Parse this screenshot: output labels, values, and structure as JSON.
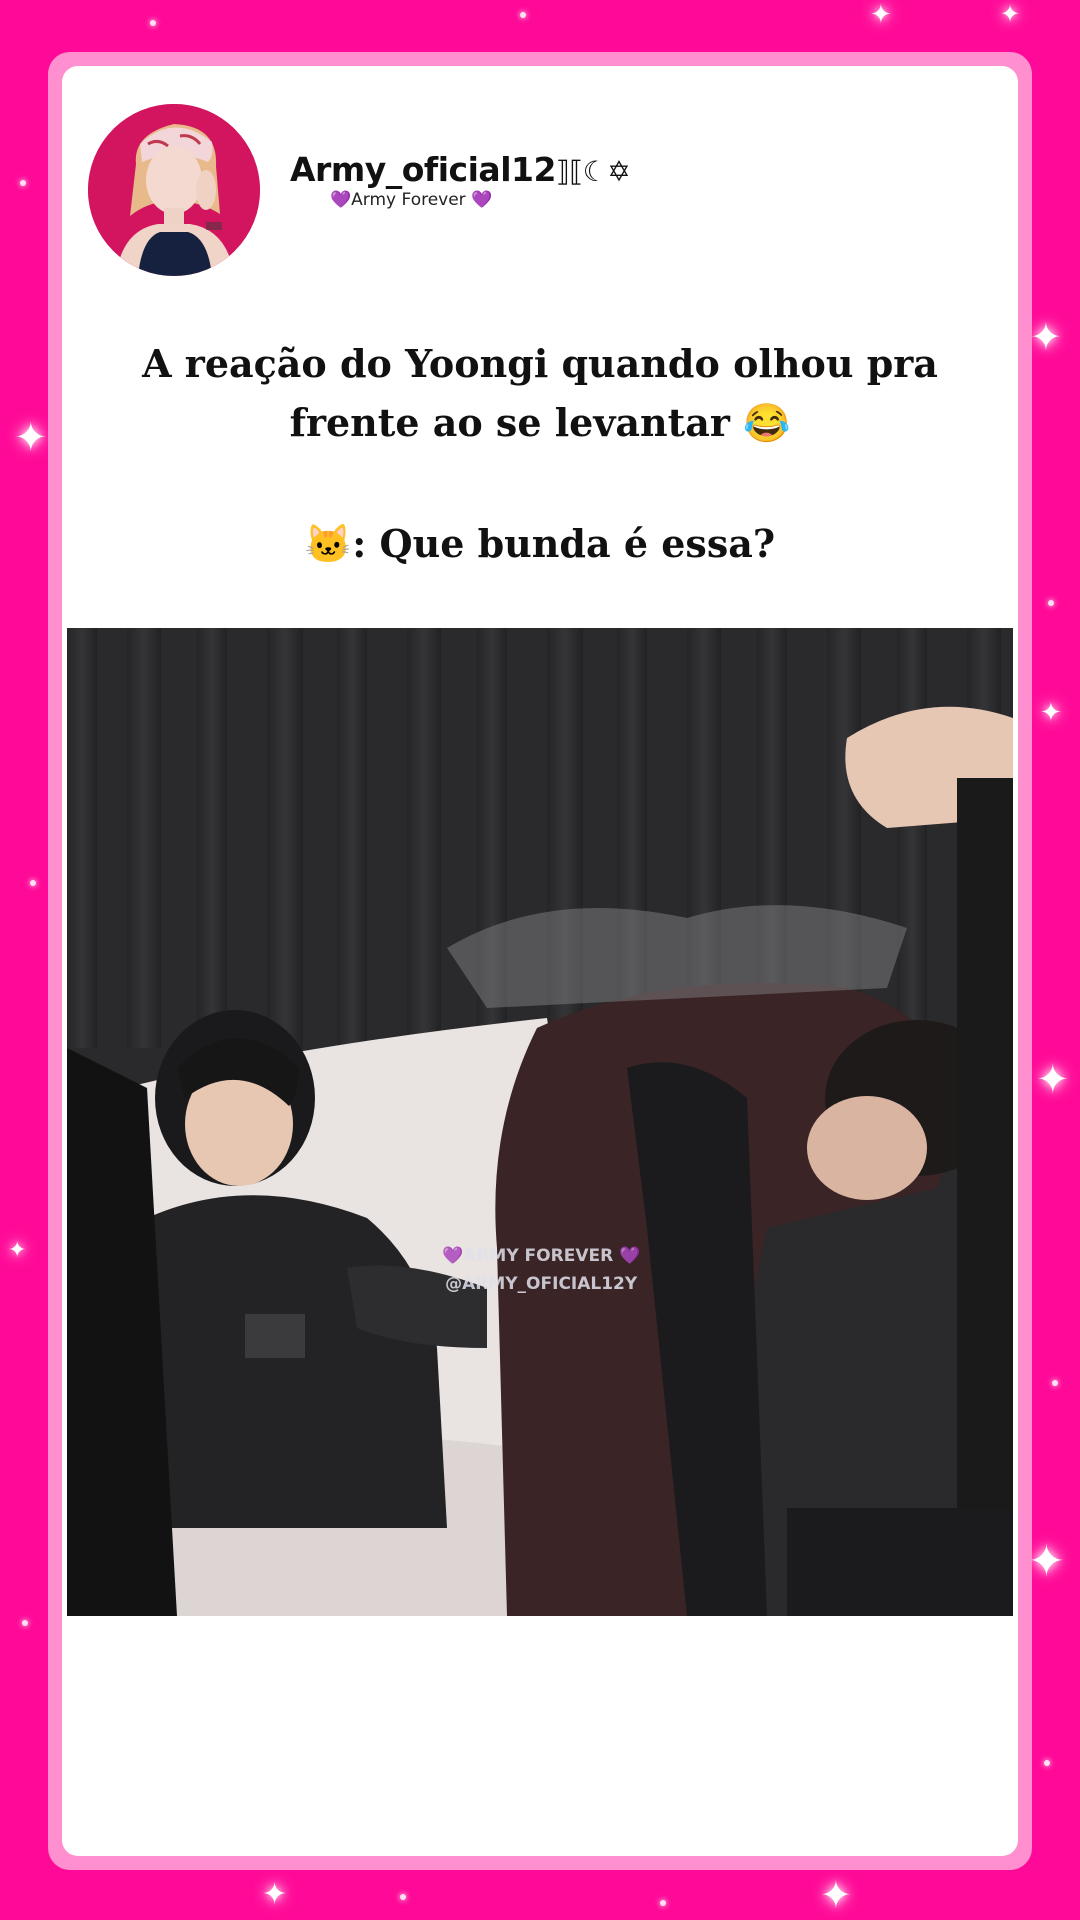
{
  "post": {
    "username": "Army_oficial12",
    "username_deco": "⟧⟦☾✡",
    "tagline_left_heart": "💜",
    "tagline_text": "Army Forever",
    "tagline_right_heart": "💜",
    "caption_line1": "A reação do Yoongi quando olhou pra frente ao se levantar 😂",
    "caption_line2": "🐱: Que bunda é essa?"
  },
  "video": {
    "watermark_line1": "💜ARMY FOREVER 💜",
    "watermark_line2": "@ARMY_OFICIAL12Y"
  },
  "colors": {
    "background": "#ff0a98",
    "frame": "#ff8fcf",
    "card": "#ffffff",
    "avatar_bg": "#d3155f",
    "curtain": "#2a2a2d",
    "sofa": "#ece6e4"
  },
  "icons": {
    "sparkle": "four-point-star",
    "avatar": "profile-photo"
  }
}
